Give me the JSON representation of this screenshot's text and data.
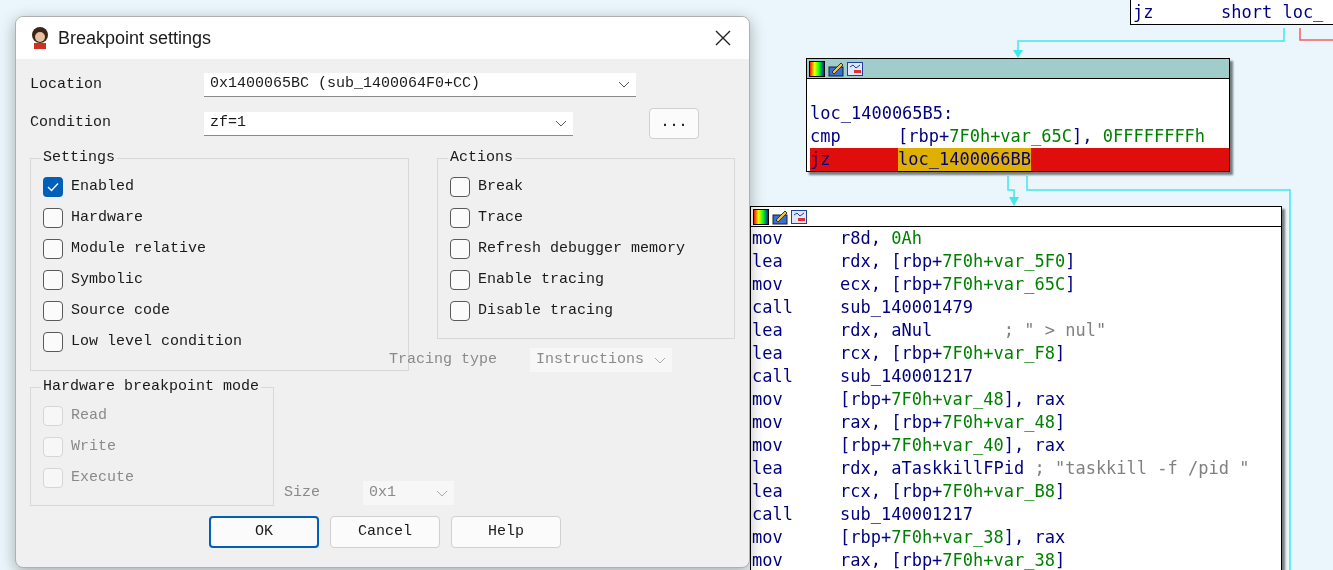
{
  "dialog": {
    "title": "Breakpoint settings",
    "location": {
      "label": "Location",
      "value": "0x1400065BC (sub_1400064F0+CC)"
    },
    "condition": {
      "label": "Condition",
      "value": "zf=1"
    },
    "more_button": "...",
    "settings": {
      "title": "Settings",
      "items": [
        {
          "label": "Enabled",
          "checked": true
        },
        {
          "label": "Hardware",
          "checked": false
        },
        {
          "label": "Module relative",
          "checked": false
        },
        {
          "label": "Symbolic",
          "checked": false
        },
        {
          "label": "Source code",
          "checked": false
        },
        {
          "label": "Low level condition",
          "checked": false
        }
      ]
    },
    "actions": {
      "title": "Actions",
      "items": [
        {
          "label": "Break",
          "checked": false
        },
        {
          "label": "Trace",
          "checked": false
        },
        {
          "label": "Refresh debugger memory",
          "checked": false
        },
        {
          "label": "Enable tracing",
          "checked": false
        },
        {
          "label": "Disable tracing",
          "checked": false
        }
      ]
    },
    "tracing_type": {
      "label": "Tracing type",
      "value": "Instructions",
      "disabled": true
    },
    "hardware_mode": {
      "title": "Hardware breakpoint mode",
      "items": [
        {
          "label": "Read",
          "checked": false,
          "disabled": true
        },
        {
          "label": "Write",
          "checked": false,
          "disabled": true
        },
        {
          "label": "Execute",
          "checked": false,
          "disabled": true
        }
      ]
    },
    "size": {
      "label": "Size",
      "value": "0x1",
      "disabled": true
    },
    "buttons": [
      {
        "label": "OK",
        "default": true
      },
      {
        "label": "Cancel",
        "default": false
      },
      {
        "label": "Help",
        "default": false
      }
    ]
  },
  "graph": {
    "nodes": [
      {
        "lines": [
          {
            "mnemonic": "jz",
            "operands": [
              {
                "text": "short loc_",
                "kind": "reg"
              }
            ]
          }
        ]
      },
      {
        "lines": [
          {
            "kind": "blank"
          },
          {
            "kind": "label",
            "text": "loc_1400065B5:"
          },
          {
            "mnemonic": "cmp",
            "operands": [
              {
                "text": "[rbp+",
                "kind": "reg"
              },
              {
                "text": "7F0h+var_65C",
                "kind": "num"
              },
              {
                "text": "], ",
                "kind": "reg"
              },
              {
                "text": "0FFFFFFFFh",
                "kind": "num"
              }
            ]
          },
          {
            "mnemonic": "jz",
            "highlighted": true,
            "operands": [
              {
                "text": "loc_1400066BB",
                "kind": "hl"
              }
            ]
          }
        ]
      },
      {
        "lines": [
          {
            "mnemonic": "mov",
            "operands": [
              {
                "text": "r8d, ",
                "kind": "reg"
              },
              {
                "text": "0Ah",
                "kind": "num"
              }
            ]
          },
          {
            "mnemonic": "lea",
            "operands": [
              {
                "text": "rdx, [rbp+",
                "kind": "reg"
              },
              {
                "text": "7F0h+var_5F0",
                "kind": "num"
              },
              {
                "text": "]",
                "kind": "reg"
              }
            ]
          },
          {
            "mnemonic": "mov",
            "operands": [
              {
                "text": "ecx, [rbp+",
                "kind": "reg"
              },
              {
                "text": "7F0h+var_65C",
                "kind": "num"
              },
              {
                "text": "]",
                "kind": "reg"
              }
            ]
          },
          {
            "mnemonic": "call",
            "operands": [
              {
                "text": "sub_140001479",
                "kind": "reg"
              }
            ]
          },
          {
            "mnemonic": "lea",
            "operands": [
              {
                "text": "rdx, aNul       ",
                "kind": "reg"
              },
              {
                "text": "; \" > nul\"",
                "kind": "comment"
              }
            ]
          },
          {
            "mnemonic": "lea",
            "operands": [
              {
                "text": "rcx, [rbp+",
                "kind": "reg"
              },
              {
                "text": "7F0h+var_F8",
                "kind": "num"
              },
              {
                "text": "]",
                "kind": "reg"
              }
            ]
          },
          {
            "mnemonic": "call",
            "operands": [
              {
                "text": "sub_140001217",
                "kind": "reg"
              }
            ]
          },
          {
            "mnemonic": "mov",
            "operands": [
              {
                "text": "[rbp+",
                "kind": "reg"
              },
              {
                "text": "7F0h+var_48",
                "kind": "num"
              },
              {
                "text": "], rax",
                "kind": "reg"
              }
            ]
          },
          {
            "mnemonic": "mov",
            "operands": [
              {
                "text": "rax, [rbp+",
                "kind": "reg"
              },
              {
                "text": "7F0h+var_48",
                "kind": "num"
              },
              {
                "text": "]",
                "kind": "reg"
              }
            ]
          },
          {
            "mnemonic": "mov",
            "operands": [
              {
                "text": "[rbp+",
                "kind": "reg"
              },
              {
                "text": "7F0h+var_40",
                "kind": "num"
              },
              {
                "text": "], rax",
                "kind": "reg"
              }
            ]
          },
          {
            "mnemonic": "lea",
            "operands": [
              {
                "text": "rdx, aTaskkillFPid ",
                "kind": "reg"
              },
              {
                "text": "; \"taskkill -f /pid \"",
                "kind": "comment"
              }
            ]
          },
          {
            "mnemonic": "lea",
            "operands": [
              {
                "text": "rcx, [rbp+",
                "kind": "reg"
              },
              {
                "text": "7F0h+var_B8",
                "kind": "num"
              },
              {
                "text": "]",
                "kind": "reg"
              }
            ]
          },
          {
            "mnemonic": "call",
            "operands": [
              {
                "text": "sub_140001217",
                "kind": "reg"
              }
            ]
          },
          {
            "mnemonic": "mov",
            "operands": [
              {
                "text": "[rbp+",
                "kind": "reg"
              },
              {
                "text": "7F0h+var_38",
                "kind": "num"
              },
              {
                "text": "], rax",
                "kind": "reg"
              }
            ]
          },
          {
            "mnemonic": "mov",
            "operands": [
              {
                "text": "rax, [rbp+",
                "kind": "reg"
              },
              {
                "text": "7F0h+var_38",
                "kind": "num"
              },
              {
                "text": "]",
                "kind": "reg"
              }
            ]
          }
        ]
      }
    ]
  }
}
